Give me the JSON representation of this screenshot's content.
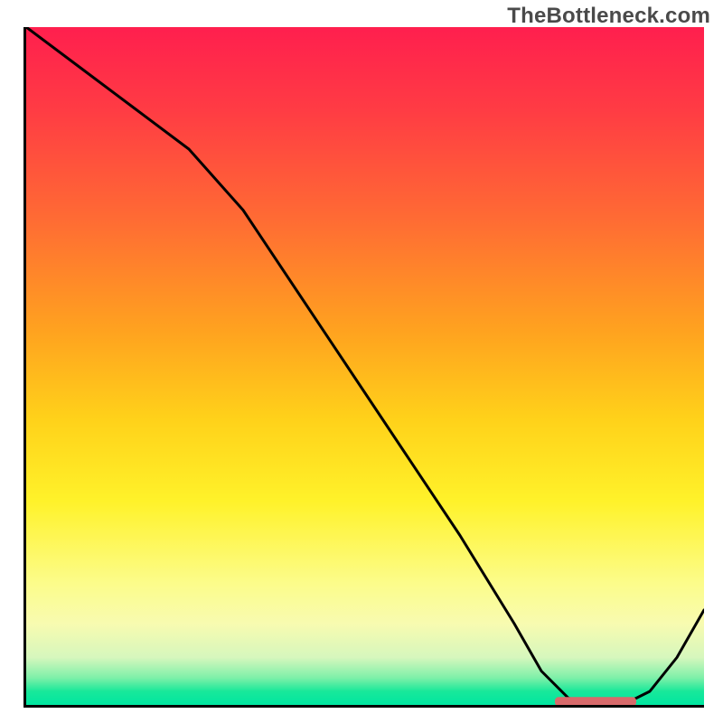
{
  "watermark": "TheBottleneck.com",
  "chart_data": {
    "type": "line",
    "title": "",
    "xlabel": "",
    "ylabel": "",
    "xlim": [
      0,
      100
    ],
    "ylim": [
      0,
      100
    ],
    "grid": false,
    "legend": null,
    "series": [
      {
        "name": "bottleneck-curve",
        "x": [
          0,
          8,
          16,
          24,
          32,
          40,
          48,
          56,
          64,
          72,
          76,
          80,
          84,
          88,
          92,
          96,
          100
        ],
        "y": [
          100,
          94,
          88,
          82,
          73,
          61,
          49,
          37,
          25,
          12,
          5,
          1,
          0,
          0,
          2,
          7,
          14
        ]
      }
    ],
    "marker": {
      "name": "optimal-band",
      "x_start": 78,
      "x_end": 90,
      "y": 0.5,
      "color": "#d86a6b"
    },
    "gradient_stops": [
      {
        "pos": 0,
        "color": "#ff1f4e"
      },
      {
        "pos": 28,
        "color": "#ff6a34"
      },
      {
        "pos": 58,
        "color": "#ffd21a"
      },
      {
        "pos": 82,
        "color": "#fcfc8a"
      },
      {
        "pos": 96,
        "color": "#7ef0a9"
      },
      {
        "pos": 100,
        "color": "#00e6a0"
      }
    ]
  }
}
